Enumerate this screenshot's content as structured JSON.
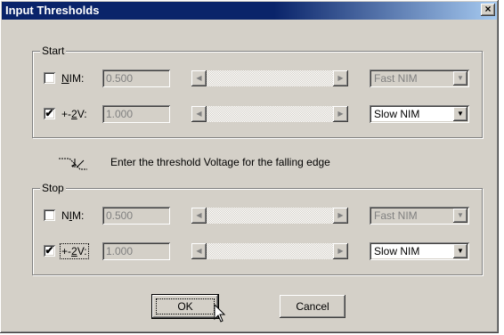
{
  "window": {
    "title": "Input Thresholds",
    "close_glyph": "×"
  },
  "start": {
    "legend": "Start",
    "nim": {
      "checked": false,
      "label_pre": "",
      "label_accel": "N",
      "label_post": "IM:",
      "value": "0.500",
      "select_value": "Fast NIM",
      "enabled": false
    },
    "v2": {
      "checked": true,
      "label_pre": "+-",
      "label_accel": "2",
      "label_post": "V:",
      "value": "1.000",
      "select_value": "Slow NIM",
      "enabled": true
    }
  },
  "hint": {
    "icon": "falling-edge-icon",
    "text": "Enter the threshold Voltage for the falling edge"
  },
  "stop": {
    "legend": "Stop",
    "nim": {
      "checked": false,
      "label_pre": "N",
      "label_accel": "I",
      "label_post": "M:",
      "value": "0.500",
      "select_value": "Fast NIM",
      "enabled": false
    },
    "v2": {
      "checked": true,
      "label_pre": "+-",
      "label_accel": "2",
      "label_post": "V:",
      "value": "1.000",
      "select_value": "Slow NIM",
      "enabled": true
    }
  },
  "buttons": {
    "ok": "OK",
    "cancel": "Cancel"
  },
  "glyphs": {
    "check": "✔",
    "unchecked": "",
    "left": "◀",
    "right": "▶",
    "down": "▼"
  },
  "colors": {
    "titlebar": "#0a246a",
    "face": "#d4d0c8",
    "disabled_text": "#808080"
  }
}
